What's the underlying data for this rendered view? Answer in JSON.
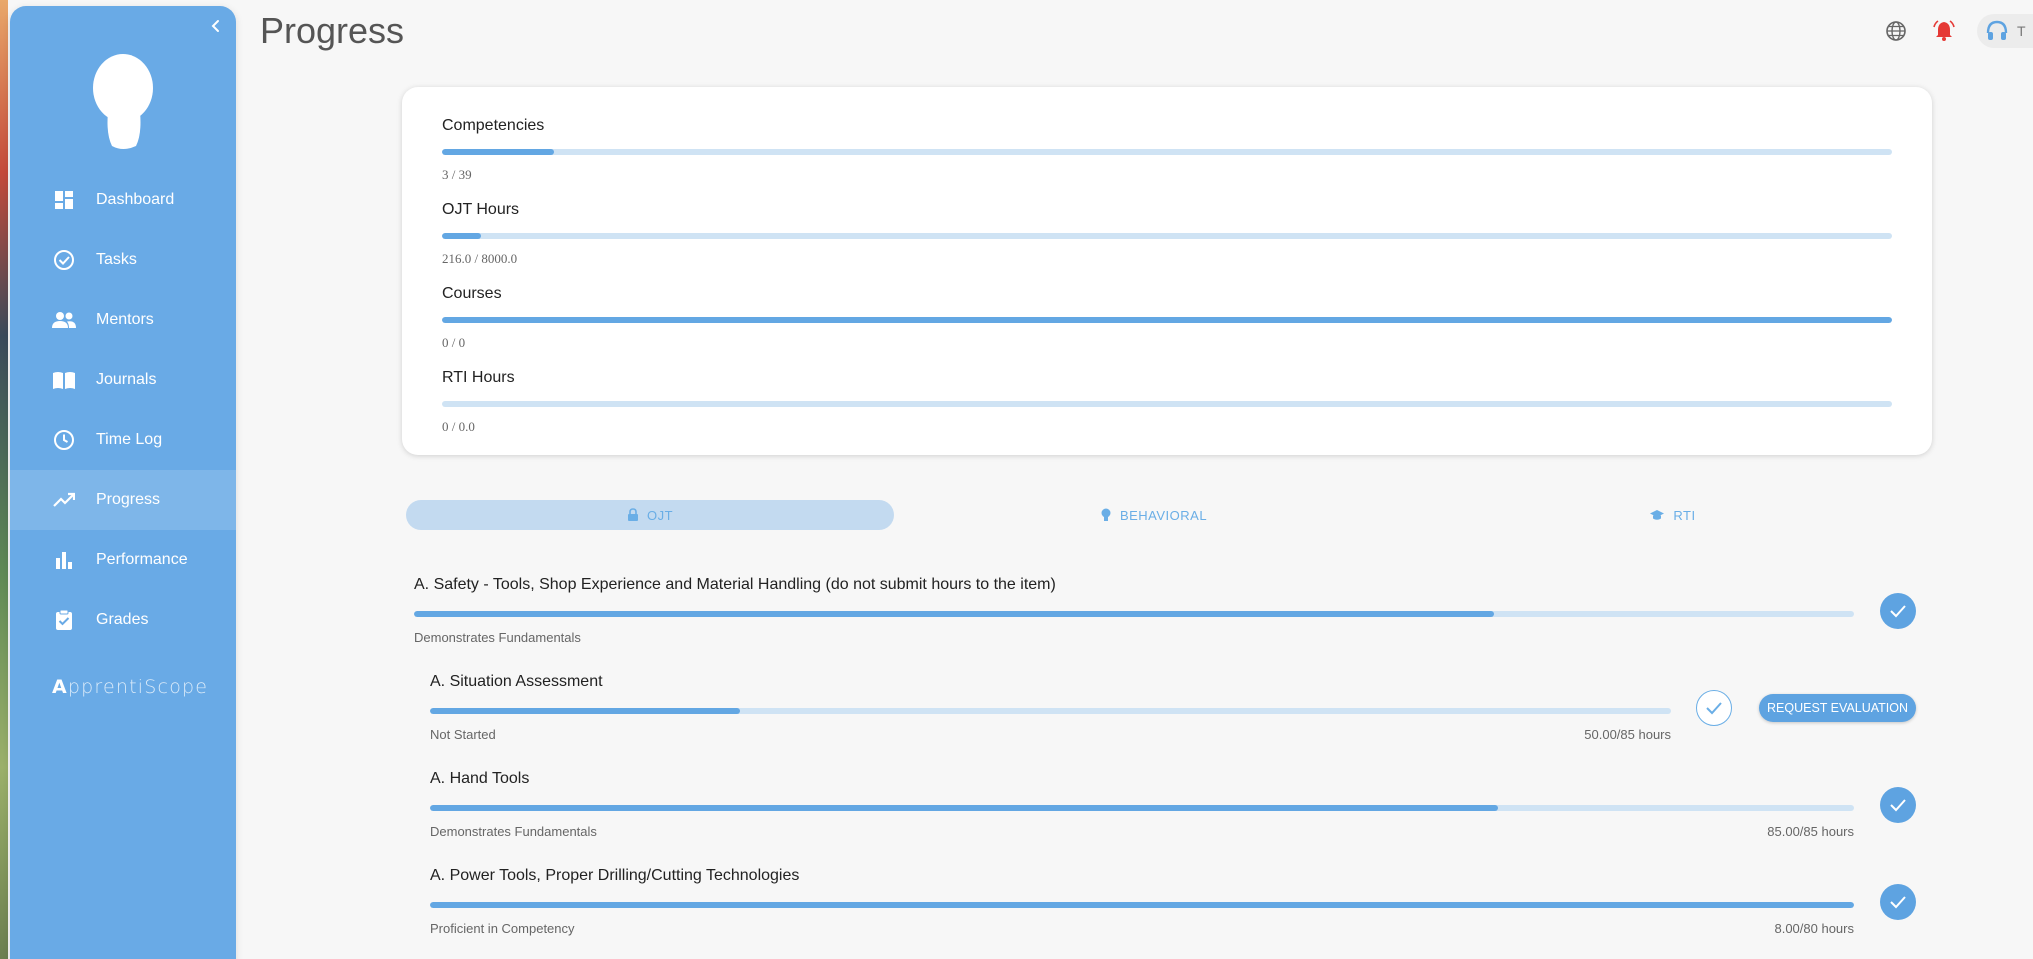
{
  "page": {
    "title": "Progress"
  },
  "sidebar": {
    "items": [
      {
        "label": "Dashboard",
        "icon": "dashboard-icon"
      },
      {
        "label": "Tasks",
        "icon": "check-circle-icon"
      },
      {
        "label": "Mentors",
        "icon": "people-icon"
      },
      {
        "label": "Journals",
        "icon": "book-icon"
      },
      {
        "label": "Time Log",
        "icon": "clock-icon"
      },
      {
        "label": "Progress",
        "icon": "trending-up-icon",
        "active": true
      },
      {
        "label": "Performance",
        "icon": "bar-chart-icon"
      },
      {
        "label": "Grades",
        "icon": "clipboard-check-icon"
      }
    ],
    "logo_mark": "A",
    "logo_text": "pprentiScope"
  },
  "header": {
    "user_initial": "T"
  },
  "summary": {
    "competencies": {
      "label": "Competencies",
      "value": "3 / 39",
      "fraction": 0.077
    },
    "ojt_hours": {
      "label": "OJT Hours",
      "value": "216.0 / 8000.0",
      "fraction": 0.027
    },
    "courses": {
      "label": "Courses",
      "value": "0 / 0",
      "fraction": 1.0
    },
    "rti_hours": {
      "label": "RTI Hours",
      "value": "0 / 0.0",
      "fraction": 0.0
    }
  },
  "tabs": [
    {
      "label": "OJT",
      "icon": "lock-icon",
      "active": true
    },
    {
      "label": "BEHAVIORAL",
      "icon": "lightbulb-icon"
    },
    {
      "label": "RTI",
      "icon": "graduation-cap-icon"
    }
  ],
  "competencies": [
    {
      "title": "A. Safety - Tools, Shop Experience and Material Handling (do not submit hours to the item)",
      "status": "Demonstrates Fundamentals",
      "hours": "",
      "progress": 0.75,
      "checked": true
    },
    {
      "title": "A. Situation Assessment",
      "status": "Not Started",
      "hours": "50.00/85 hours",
      "progress": 0.25,
      "checked": false,
      "action": "REQUEST EVALUATION"
    },
    {
      "title": "A. Hand Tools",
      "status": "Demonstrates Fundamentals",
      "hours": "85.00/85 hours",
      "progress": 0.75,
      "checked": true
    },
    {
      "title": "A. Power Tools, Proper Drilling/Cutting Technologies",
      "status": "Proficient in Competency",
      "hours": "8.00/80 hours",
      "progress": 1.0,
      "checked": true
    }
  ],
  "colors": {
    "sidebar": "#69aae6",
    "accent": "#5ea3e1",
    "track": "#cfe3f4",
    "alert": "#e53935"
  }
}
